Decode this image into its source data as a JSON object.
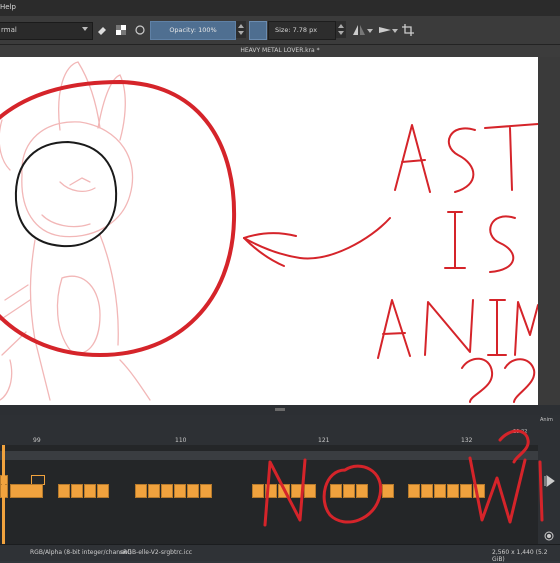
{
  "menubar": {
    "help_label": "Help"
  },
  "toolbar": {
    "blend_mode": "rmal",
    "opacity_label": "Opacity: 100%",
    "size_label": "Size: 7.78 px"
  },
  "document": {
    "title": "HEAVY METAL LOVER.kra *"
  },
  "timeline": {
    "frame_numbers": [
      "99",
      "110",
      "121",
      "132"
    ],
    "right_panel_label": "Anim",
    "small_number": "20 22"
  },
  "statusbar": {
    "color_mode": "RGB/Alpha (8-bit integer/channel)",
    "profile": "sRGB-elle-V2-srgbtrc.icc",
    "dimensions": "2,560 x 1,440 (5.2 GiB)"
  },
  "drawing": {
    "handwritten_text": "ASTA IS ANIM ?? NO WI"
  },
  "colors": {
    "accent": "#4f6f91",
    "keyframe": "#f0a23e",
    "ink_red": "#d5242a"
  }
}
